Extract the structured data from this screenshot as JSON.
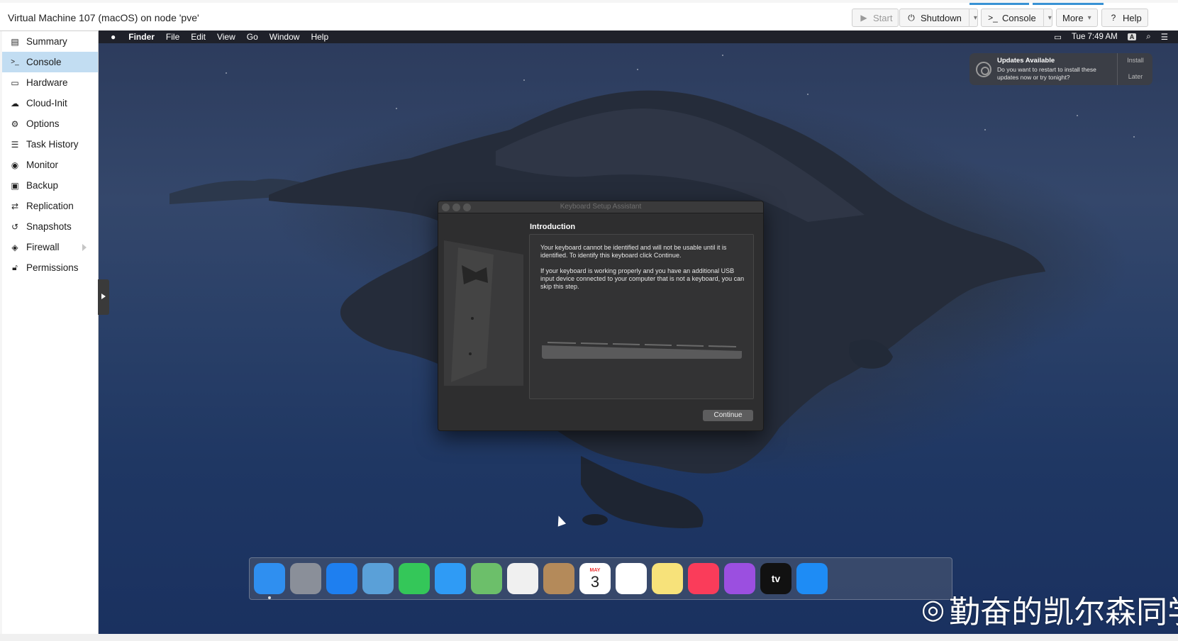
{
  "window": {
    "title": "Virtual Machine 107 (macOS) on node 'pve'"
  },
  "toolbar": {
    "start_label": "Start",
    "shutdown_label": "Shutdown",
    "console_label": "Console",
    "more_label": "More",
    "help_label": "Help",
    "start_icon": "play-icon",
    "shutdown_icon": "power-icon",
    "console_icon": "terminal-icon",
    "help_icon": "question-circle-icon"
  },
  "sidebar": {
    "items": [
      {
        "label": "Summary",
        "icon": "book-icon"
      },
      {
        "label": "Console",
        "icon": "terminal-icon",
        "active": true
      },
      {
        "label": "Hardware",
        "icon": "desktop-icon"
      },
      {
        "label": "Cloud-Init",
        "icon": "cloud-icon"
      },
      {
        "label": "Options",
        "icon": "gear-icon"
      },
      {
        "label": "Task History",
        "icon": "list-icon"
      },
      {
        "label": "Monitor",
        "icon": "eye-icon"
      },
      {
        "label": "Backup",
        "icon": "floppy-icon"
      },
      {
        "label": "Replication",
        "icon": "retweet-icon"
      },
      {
        "label": "Snapshots",
        "icon": "history-icon"
      },
      {
        "label": "Firewall",
        "icon": "shield-icon",
        "has_submenu": true
      },
      {
        "label": "Permissions",
        "icon": "unlock-icon"
      }
    ]
  },
  "mac": {
    "menubar": {
      "app": "Finder",
      "menus": [
        "File",
        "Edit",
        "View",
        "Go",
        "Window",
        "Help"
      ],
      "clock": "Tue 7:49 AM",
      "input_source": "A"
    },
    "notification": {
      "title": "Updates Available",
      "body": "Do you want to restart to install these updates now or try tonight?",
      "install_label": "Install",
      "later_label": "Later"
    },
    "dialog": {
      "title": "Keyboard Setup Assistant",
      "heading": "Introduction",
      "paragraph1": "Your keyboard cannot be identified and will not be usable until it is identified. To identify this keyboard click Continue.",
      "paragraph2": "If your keyboard is working properly and you have an additional USB input device connected to your computer that is not a keyboard, you can skip this step.",
      "continue_label": "Continue"
    },
    "dock": {
      "apps": [
        {
          "name": "Finder",
          "color": "#2f8ff0"
        },
        {
          "name": "Launchpad",
          "color": "#8a8f99"
        },
        {
          "name": "Safari",
          "color": "#1e7ff0"
        },
        {
          "name": "Mail",
          "color": "#5aa0d8"
        },
        {
          "name": "FaceTime",
          "color": "#34c759"
        },
        {
          "name": "Messages",
          "color": "#2f9bf5"
        },
        {
          "name": "Maps",
          "color": "#6cbf6a"
        },
        {
          "name": "Photos",
          "color": "#f0f0f0"
        },
        {
          "name": "Contacts",
          "color": "#b48a5a"
        },
        {
          "name": "Calendar",
          "color": "#ffffff",
          "month": "MAY",
          "day": "3"
        },
        {
          "name": "Reminders",
          "color": "#ffffff"
        },
        {
          "name": "Notes",
          "color": "#f7e27a"
        },
        {
          "name": "Music",
          "color": "#fa3c5a"
        },
        {
          "name": "Podcasts",
          "color": "#9b4fe0"
        },
        {
          "name": "TV",
          "color": "#111111",
          "label": "tv"
        },
        {
          "name": "App Store",
          "color": "#1e8cf5"
        }
      ]
    }
  },
  "watermark": {
    "text": "勤奋的凯尔森同学"
  }
}
